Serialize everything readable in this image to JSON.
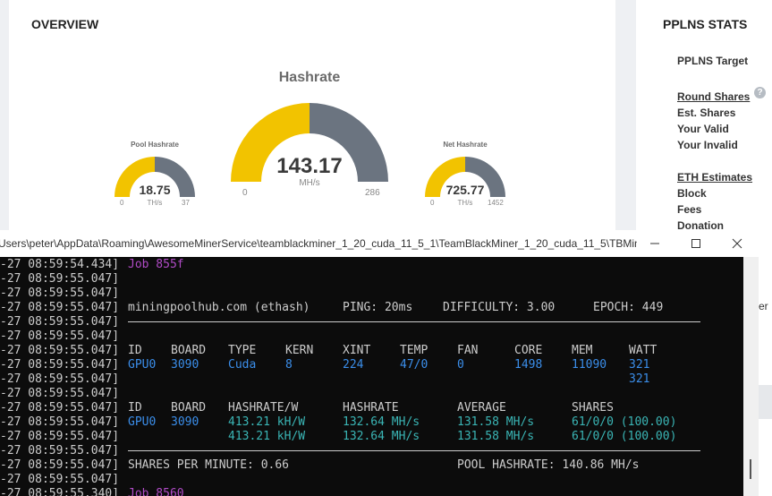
{
  "overview": {
    "title": "OVERVIEW",
    "main_gauge": {
      "title": "Hashrate",
      "value": "143.17",
      "unit": "MH/s",
      "min": "0",
      "max": "286",
      "fraction": 0.5
    },
    "pool_gauge": {
      "title": "Pool Hashrate",
      "value": "18.75",
      "unit": "TH/s",
      "min": "0",
      "max": "37",
      "fraction": 0.5
    },
    "net_gauge": {
      "title": "Net Hashrate",
      "value": "725.77",
      "unit": "TH/s",
      "min": "0",
      "max": "1452",
      "fraction": 0.5
    },
    "colors": {
      "fill": "#f2c300",
      "track": "#6b7480"
    }
  },
  "pplns": {
    "title": "PPLNS STATS",
    "target": "PPLNS Target",
    "round_shares": "Round Shares",
    "help_icon": "?",
    "est_shares": "Est. Shares",
    "your_valid": "Your Valid",
    "your_invalid": "Your Invalid",
    "eth_estimates": "ETH Estimates",
    "block": "Block",
    "fees": "Fees",
    "donation": "Donation",
    "partial_text": "er"
  },
  "terminal": {
    "title": "Users\\peter\\AppData\\Roaming\\AwesomeMinerService\\teamblackminer_1_20_cuda_11_5_1\\TeamBlackMiner_1_20_cuda_11_5\\TBMine...",
    "minimize_icon": "minimize-icon",
    "maximize_icon": "maximize-icon",
    "close_icon": "close-icon",
    "colors": {
      "bg": "#0c0c0c",
      "text": "#cccccc",
      "blue": "#3b8eea",
      "teal": "#3ab5b5",
      "purple": "#b04bc6"
    },
    "timestamps": [
      "-27 08:59:54.434]",
      "-27 08:59:55.047]",
      "-27 08:59:55.047]",
      "-27 08:59:55.047]",
      "-27 08:59:55.047]",
      "-27 08:59:55.047]",
      "-27 08:59:55.047]",
      "-27 08:59:55.047]",
      "-27 08:59:55.047]",
      "-27 08:59:55.047]",
      "-27 08:59:55.047]",
      "-27 08:59:55.047]",
      "-27 08:59:55.047]",
      "-27 08:59:55.047]",
      "-27 08:59:55.047]",
      "-27 08:59:55.047]",
      "-27 08:59:55.340]"
    ],
    "job_first": "Job 855f",
    "job_last": "Job 8560",
    "pool": "miningpoolhub.com (ethash)",
    "ping": "PING: 20ms",
    "difficulty": "DIFFICULTY: 3.00",
    "epoch": "EPOCH: 449",
    "dev_headers": [
      "ID",
      "BOARD",
      "TYPE",
      "KERN",
      "XINT",
      "TEMP",
      "FAN",
      "CORE",
      "MEM",
      "WATT"
    ],
    "dev_row": [
      "GPU0",
      "3090",
      "Cuda",
      "8",
      "224",
      "47/0",
      "0",
      "1498",
      "11090",
      "321"
    ],
    "watt_total": "321",
    "hash_headers": [
      "ID",
      "BOARD",
      "HASHRATE/W",
      "HASHRATE",
      "AVERAGE",
      "SHARES"
    ],
    "hash_row": [
      "GPU0",
      "3090",
      "413.21 kH/W",
      "132.64 MH/s",
      "131.58 MH/s",
      "61/0/0 (100.00)"
    ],
    "hash_total": [
      "413.21 kH/W",
      "132.64 MH/s",
      "131.58 MH/s",
      "61/0/0 (100.00)"
    ],
    "shares_per_minute": "SHARES PER MINUTE: 0.66",
    "pool_hashrate": "POOL HASHRATE: 140.86 MH/s"
  }
}
